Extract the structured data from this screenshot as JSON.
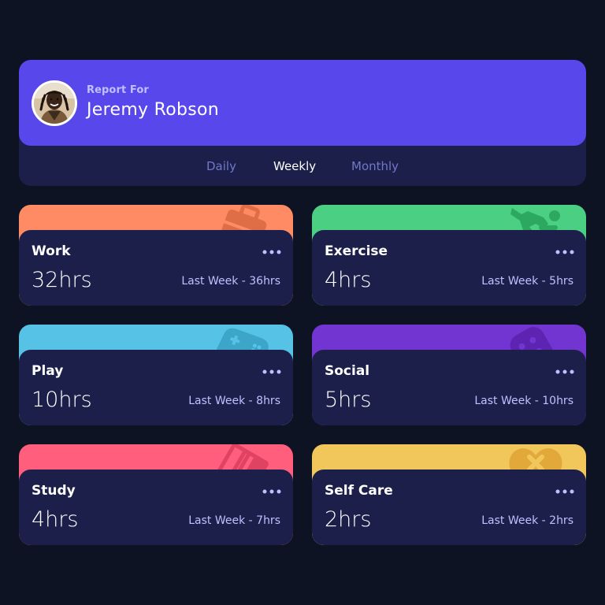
{
  "header": {
    "report_label": "Report For",
    "user_name": "Jeremy Robson"
  },
  "tabs": [
    {
      "label": "Daily",
      "active": false
    },
    {
      "label": "Weekly",
      "active": true
    },
    {
      "label": "Monthly",
      "active": false
    }
  ],
  "activities": [
    {
      "title": "Work",
      "current": "32hrs",
      "previous": "Last Week - 36hrs",
      "color": "#ff8b64",
      "icon": "briefcase-icon"
    },
    {
      "title": "Exercise",
      "current": "4hrs",
      "previous": "Last Week - 5hrs",
      "color": "#4bcf82",
      "icon": "running-icon"
    },
    {
      "title": "Play",
      "current": "10hrs",
      "previous": "Last Week - 8hrs",
      "color": "#55c2e6",
      "icon": "gamepad-icon"
    },
    {
      "title": "Social",
      "current": "5hrs",
      "previous": "Last Week - 10hrs",
      "color": "#7335d2",
      "icon": "chat-icon"
    },
    {
      "title": "Study",
      "current": "4hrs",
      "previous": "Last Week - 7hrs",
      "color": "#ff5e7d",
      "icon": "books-icon"
    },
    {
      "title": "Self Care",
      "current": "2hrs",
      "previous": "Last Week - 2hrs",
      "color": "#f1c75b",
      "icon": "heart-plus-icon"
    }
  ],
  "colors": {
    "background": "#0e1323",
    "card": "#1c1f4a",
    "accent": "#5847eb",
    "muted_text": "#bdc1ff",
    "inactive_tab": "#7078c9"
  }
}
